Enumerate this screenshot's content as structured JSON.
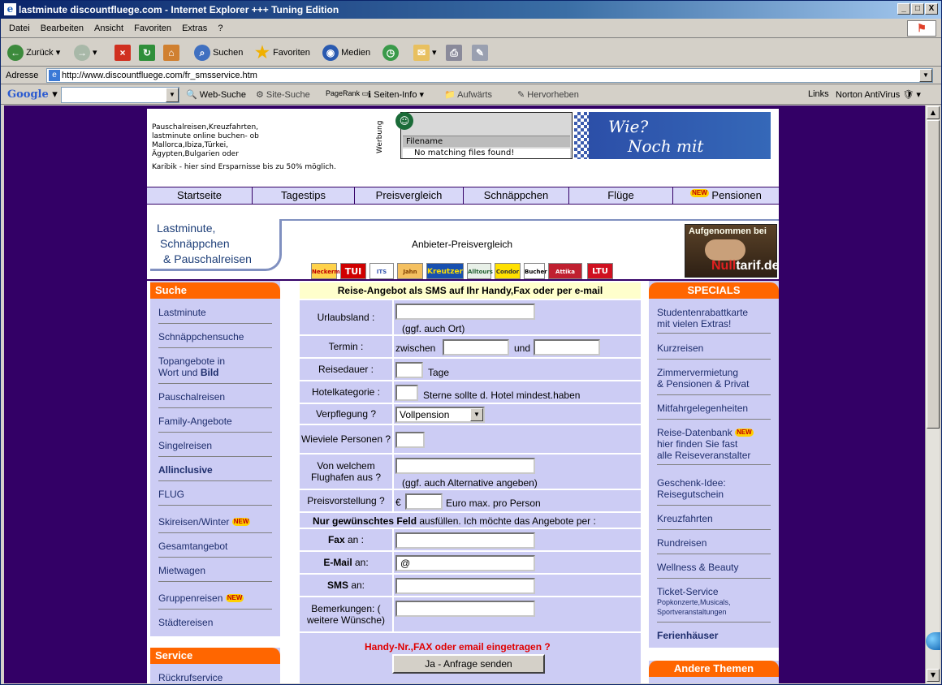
{
  "window": {
    "title": "lastminute discountfluege.com - Internet Explorer +++ Tuning Edition",
    "ie_icon": "e"
  },
  "window_controls": {
    "minimize": "_",
    "maximize": "□",
    "close": "X"
  },
  "menu": [
    "Datei",
    "Bearbeiten",
    "Ansicht",
    "Favoriten",
    "Extras",
    "?"
  ],
  "toolbar": {
    "back": "Zurück",
    "search": "Suchen",
    "favorites": "Favoriten",
    "media": "Medien"
  },
  "address": {
    "label": "Adresse",
    "url": "http://www.discountfluege.com/fr_smsservice.htm"
  },
  "google_bar": {
    "logo": "Google",
    "web_search": "Web-Suche",
    "site_search": "Site-Suche",
    "pagerank": "PageRank",
    "page_info": "Seiten-Info",
    "up": "Aufwärts",
    "highlight": "Hervorheben",
    "links": "Links",
    "norton": "Norton AntiVirus"
  },
  "header": {
    "promo_text": "Pauschalreisen,Kreuzfahrten, lastminute online buchen- ob Mallorca,Ibiza,Türkei, Ägypten,Bulgarien oder",
    "promo_text2": "Karibik - hier sind Ersparnisse bis zu 50% möglich.",
    "ad_label": "Werbung",
    "ad_filename": "Filename",
    "ad_nomatch": "No matching files found!",
    "ad_line1": "Wie?",
    "ad_line2": "Noch mit Napster????"
  },
  "nav": [
    "Startseite",
    "Tagestips",
    "Preisvergleich",
    "Schnäppchen",
    "Flüge",
    "Pensionen"
  ],
  "new_badge": "NEW",
  "banner": {
    "logo_line1": "Lastminute,",
    "logo_line2": "Schnäppchen",
    "logo_line3": "& Pauschalreisen",
    "center_label": "Anbieter-Preisvergleich",
    "partner_logos": [
      "Neckermann",
      "TUI",
      "ITS",
      "Jahn",
      "Kreutzer",
      "Alltours",
      "Condor",
      "Bucher",
      "Attika",
      "LTU"
    ],
    "tarif_top": "Aufgenommen bei",
    "tarif_brand_a": "Null",
    "tarif_brand_b": "tarif.de"
  },
  "left": {
    "heading": "Suche",
    "links": [
      "Lastminute",
      "Schnäppchensuche",
      "Topangebote in",
      "Wort und",
      "Bild",
      "Pauschalreisen",
      "Family-Angebote",
      "Singelreisen",
      "Allinclusive",
      "FLUG",
      "Skireisen/Winter",
      "Gesamtangebot",
      "Mietwagen",
      "Gruppenreisen",
      "Städtereisen"
    ],
    "heading2": "Service",
    "service_link": "Rückrufservice"
  },
  "form": {
    "title": "Reise-Angebot als SMS auf Ihr Handy,Fax oder per e-mail",
    "urlaubsland_label": "Urlaubsland :",
    "urlaubsland_hint": "(ggf. auch Ort)",
    "termin_label": "Termin :",
    "termin_from": "zwischen",
    "termin_and": "und",
    "dauer_label": "Reisedauer :",
    "dauer_unit": "Tage",
    "kategorie_label": "Hotelkategorie :",
    "kategorie_hint": "Sterne sollte d. Hotel mindest.haben",
    "verpflegung_label": "Verpflegung ?",
    "verpflegung_value": "Vollpension",
    "personen_label": "Wieviele Personen ?",
    "flughafen_label": "Von welchem Flughafen aus ?",
    "flughafen_hint": "(ggf. auch Alternative angeben)",
    "preis_label": "Preisvorstellung ?",
    "preis_currency": "€",
    "preis_hint": "Euro max. pro Person",
    "note_bold": "Nur gewünschtes Feld",
    "note_rest": " ausfüllen. Ich möchte das Angebote per :",
    "fax_bold": "Fax",
    "fax_rest": " an :",
    "email_bold": "E-Mail",
    "email_rest": " an:",
    "email_value": "@",
    "sms_bold": "SMS",
    "sms_rest": " an:",
    "bemerk_label": "Bemerkungen: ( weitere Wünsche)",
    "warning": "Handy-Nr.,FAX oder email eingetragen ?",
    "submit": "Ja - Anfrage senden"
  },
  "right": {
    "heading": "SPECIALS",
    "links": [
      "Studentenrabattkarte",
      "mit vielen Extras!",
      "Kurzreisen",
      "Zimmervermietung",
      "& Pensionen & Privat",
      "Mitfahrgelegenheiten",
      "Reise-Datenbank",
      "hier finden Sie fast",
      "alle Reiseveranstalter",
      "Geschenk-Idee:",
      "Reisegutschein",
      "Kreuzfahrten",
      "Rundreisen",
      "Wellness & Beauty",
      "Ticket-Service",
      "Popkonzerte,Musicals,",
      "Sportveranstaltungen",
      "Ferienhäuser"
    ],
    "heading2": "Andere Themen"
  }
}
